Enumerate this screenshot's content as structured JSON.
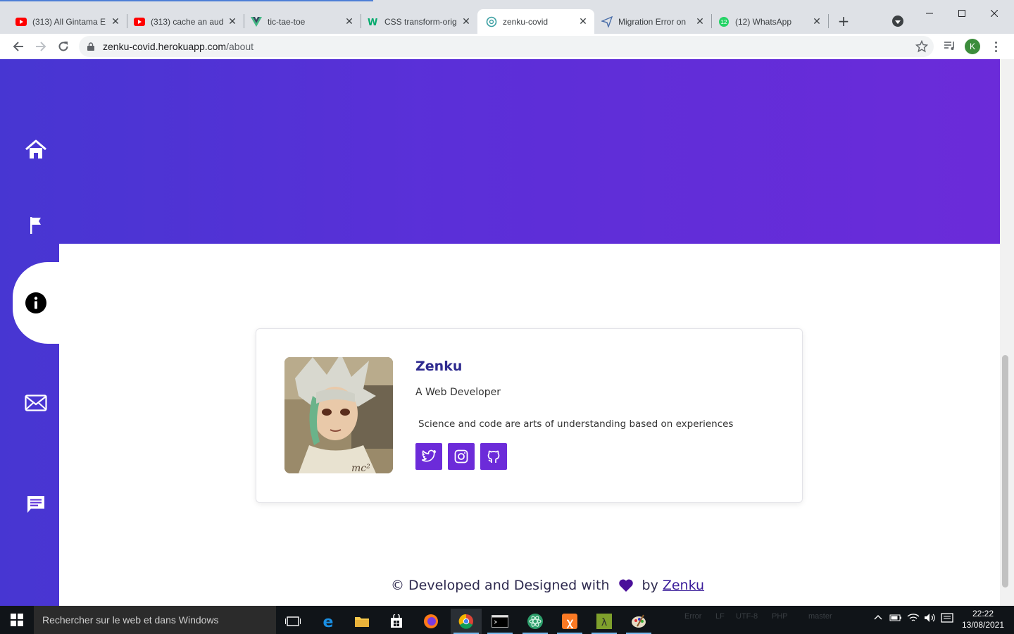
{
  "browser": {
    "tabs": [
      {
        "title": "(313) All Gintama E",
        "icon": "youtube-icon"
      },
      {
        "title": "(313) cache an aud",
        "icon": "youtube-icon"
      },
      {
        "title": "tic-tae-toe",
        "icon": "vue-icon"
      },
      {
        "title": "CSS transform-orig",
        "icon": "w3-icon"
      },
      {
        "title": "zenku-covid",
        "icon": "heroku-icon",
        "active": true
      },
      {
        "title": "Migration Error on",
        "icon": "send-icon"
      },
      {
        "title": "(12) WhatsApp",
        "icon": "whatsapp-icon",
        "badge": "12"
      }
    ],
    "new_tab": "+",
    "url_host": "zenku-covid.herokuapp.com",
    "url_path": "/about",
    "profile_initial": "K"
  },
  "sidebar": {
    "items": [
      {
        "name": "home",
        "icon": "home-icon"
      },
      {
        "name": "flag",
        "icon": "flag-icon"
      },
      {
        "name": "about",
        "icon": "info-icon",
        "active": true
      },
      {
        "name": "contact",
        "icon": "mail-icon"
      },
      {
        "name": "chat",
        "icon": "chat-icon"
      }
    ]
  },
  "profile_card": {
    "name": "Zenku",
    "role": "A Web Developer",
    "quote": "Science and code are arts of understanding based on experiences",
    "socials": [
      "twitter-icon",
      "instagram-icon",
      "github-icon"
    ]
  },
  "footer": {
    "prefix": "© Developed and Designed with",
    "by": "by",
    "author": "Zenku"
  },
  "colors": {
    "brand_purple": "#6c2bd9",
    "gradient_start": "#4736d2",
    "gradient_end": "#6b2bd9",
    "heading": "#2e2a8f"
  },
  "taskbar": {
    "search_placeholder": "Rechercher sur le web et dans Windows",
    "ghost_text": [
      "Error",
      "LF",
      "UTF-8",
      "PHP",
      "master"
    ],
    "time": "22:22",
    "date": "13/08/2021"
  }
}
